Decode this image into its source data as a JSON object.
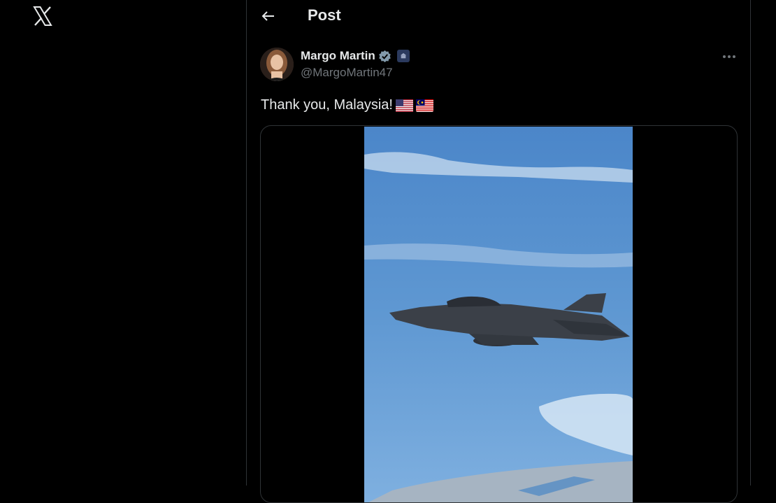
{
  "header": {
    "title": "Post",
    "back_icon": "arrow-left-icon"
  },
  "nav": {
    "logo_icon": "x-logo-icon"
  },
  "post": {
    "author_name": "Margo Martin",
    "handle": "@MargoMartin47",
    "verified_icon": "verified-badge-icon",
    "affiliation_icon": "government-affiliation-icon",
    "more_icon": "more-horizontal-icon",
    "text": "Thank you, Malaysia!",
    "flags": [
      "us-flag",
      "malaysia-flag"
    ],
    "media": {
      "type": "video",
      "subject": "fighter-jet-in-flight"
    }
  },
  "colors": {
    "background": "#000000",
    "text": "#e7e9ea",
    "secondary": "#71767b",
    "border": "#2f3336",
    "verified": "#829aab"
  }
}
